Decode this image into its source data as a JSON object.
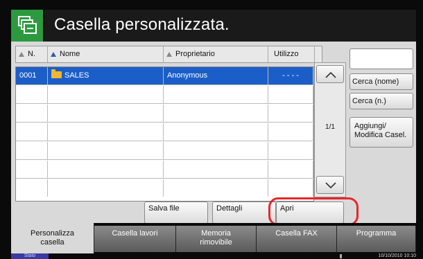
{
  "header": {
    "title": "Casella personalizzata.",
    "icon": "box-stack-icon"
  },
  "table": {
    "columns": [
      {
        "label": "N.",
        "sort_active": false
      },
      {
        "label": "Nome",
        "sort_active": true
      },
      {
        "label": "Proprietario",
        "sort_active": false
      },
      {
        "label": "Utilizzo",
        "sort_active": false
      }
    ],
    "rows": [
      {
        "number": "0001",
        "name": "SALES",
        "owner": "Anonymous",
        "usage": "- - - -",
        "selected": true
      },
      {
        "number": "",
        "name": "",
        "owner": "",
        "usage": ""
      },
      {
        "number": "",
        "name": "",
        "owner": "",
        "usage": ""
      },
      {
        "number": "",
        "name": "",
        "owner": "",
        "usage": ""
      },
      {
        "number": "",
        "name": "",
        "owner": "",
        "usage": ""
      },
      {
        "number": "",
        "name": "",
        "owner": "",
        "usage": ""
      },
      {
        "number": "",
        "name": "",
        "owner": "",
        "usage": ""
      }
    ]
  },
  "scroll": {
    "page_indicator": "1/1"
  },
  "side": {
    "search_name_label": "Cerca (nome)",
    "search_number_label": "Cerca (n.)",
    "add_edit_label_1": "Aggiungi/",
    "add_edit_label_2": "Modifica Casel."
  },
  "actions": {
    "save_file": "Salva file",
    "details": "Dettagli",
    "open": "Apri"
  },
  "tabs": [
    {
      "label_1": "Personalizza",
      "label_2": "casella",
      "active": true
    },
    {
      "label_1": "Casella lavori",
      "label_2": "",
      "active": false
    },
    {
      "label_1": "Memoria",
      "label_2": "rimovibile",
      "active": false
    },
    {
      "label_1": "Casella FAX",
      "label_2": "",
      "active": false
    },
    {
      "label_1": "Programma",
      "label_2": "",
      "active": false
    }
  ],
  "status": {
    "button": "Stato",
    "datetime": "10/10/2010  10:10"
  },
  "colors": {
    "accent_green": "#2b9a3e",
    "selection_blue": "#1c5ec8",
    "highlight_red": "#e8262a"
  }
}
